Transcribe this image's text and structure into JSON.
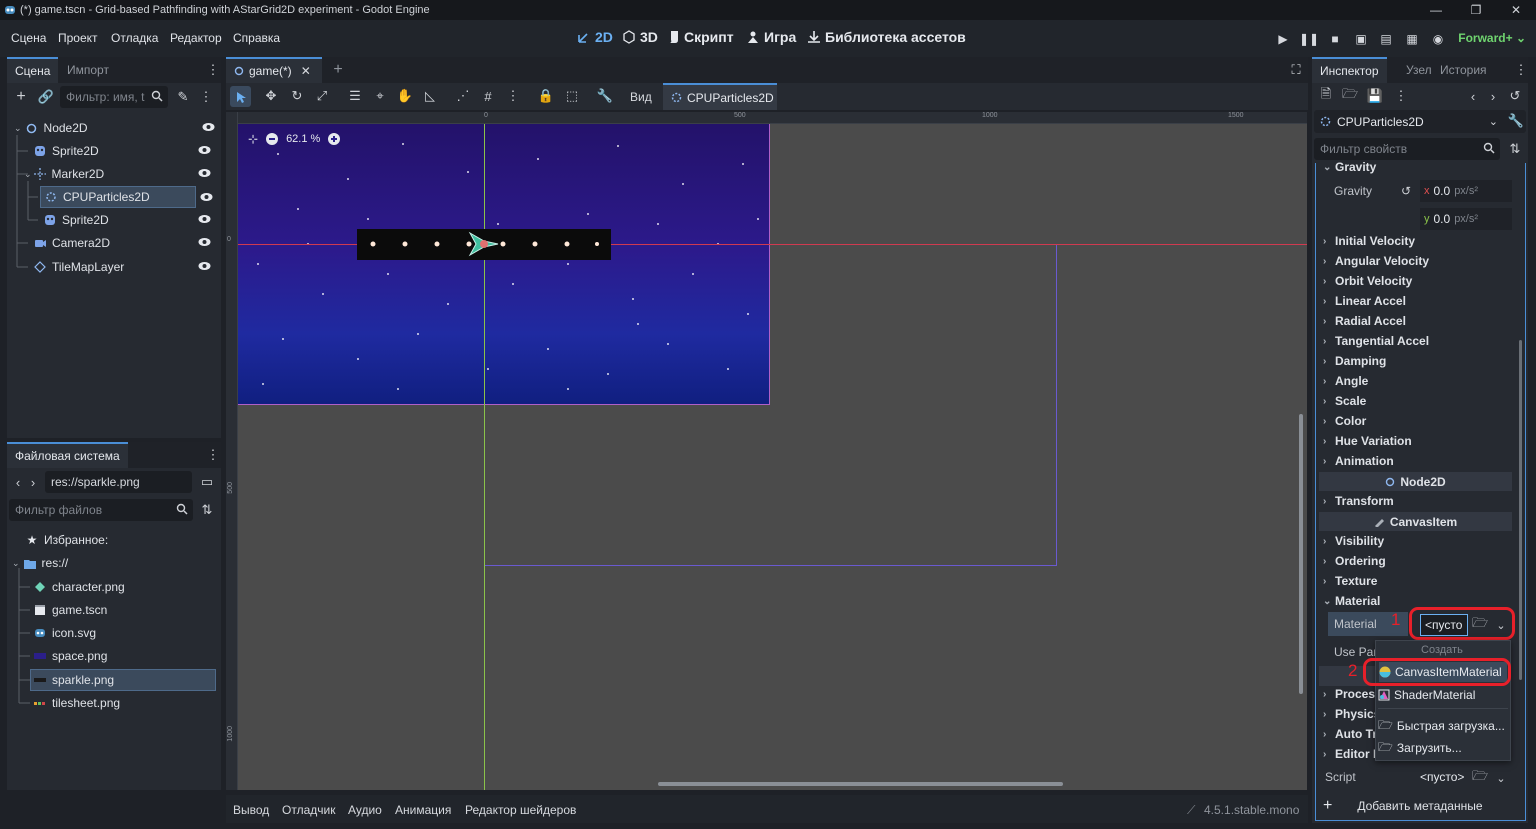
{
  "window": {
    "title": "(*) game.tscn - Grid-based Pathfinding with AStarGrid2D experiment - Godot Engine",
    "minimize": "—",
    "restore": "❐",
    "close": "✕"
  },
  "menu": [
    "Сцена",
    "Проект",
    "Отладка",
    "Редактор",
    "Справка"
  ],
  "workspaces": [
    "2D",
    "3D",
    "Скрипт",
    "Игра",
    "Библиотека ассетов"
  ],
  "renderer": "Forward+",
  "scene_dock": {
    "tabs": [
      "Сцена",
      "Импорт"
    ],
    "filter_placeholder": "Фильтр: имя, t",
    "nodes": [
      "Node2D",
      "Sprite2D",
      "Marker2D",
      "CPUParticles2D",
      "Sprite2D",
      "Camera2D",
      "TileMapLayer"
    ]
  },
  "filesystem_dock": {
    "tab": "Файловая система",
    "path": "res://sparkle.png",
    "filter_placeholder": "Фильтр файлов",
    "favorites": "Избранное:",
    "root": "res://",
    "files": [
      "character.png",
      "game.tscn",
      "icon.svg",
      "space.png",
      "sparkle.png",
      "tilesheet.png"
    ]
  },
  "editor": {
    "scene_tab": "game(*)",
    "view_label": "Вид",
    "selected_node": "CPUParticles2D",
    "zoom": "62.1 %",
    "ruler_labels": [
      "0",
      "500",
      "1000",
      "1500"
    ],
    "vruler_labels": [
      "0",
      "500",
      "1000"
    ]
  },
  "bottom_panel": {
    "tabs": [
      "Вывод",
      "Отладчик",
      "Аудио",
      "Анимация",
      "Редактор шейдеров"
    ],
    "version": "4.5.1.stable.mono"
  },
  "inspector": {
    "tabs": [
      "Инспектор",
      "Узел",
      "История"
    ],
    "node": "CPUParticles2D",
    "filter_placeholder": "Фильтр свойств",
    "gravity_group": "Gravity",
    "gravity_label": "Gravity",
    "gravity_x_axis": "x",
    "gravity_x": "0.0",
    "gravity_y_axis": "y",
    "gravity_y": "0.0",
    "gravity_unit": "px/s²",
    "sections": [
      "Initial Velocity",
      "Angular Velocity",
      "Orbit Velocity",
      "Linear Accel",
      "Radial Accel",
      "Tangential Accel",
      "Damping",
      "Angle",
      "Scale",
      "Color",
      "Hue Variation",
      "Animation"
    ],
    "node2d_header": "Node2D",
    "transform": "Transform",
    "canvasitem_header": "CanvasItem",
    "canvas_sections": [
      "Visibility",
      "Ordering",
      "Texture",
      "Material"
    ],
    "material_label": "Material",
    "material_value": "<пусто",
    "use_parent_label": "Use Par",
    "lower_sections": [
      "Process",
      "Physics",
      "Auto Tra",
      "Editor D"
    ],
    "script_label": "Script",
    "script_value": "<пусто>",
    "add_metadata": "Добавить метаданные"
  },
  "material_dropdown": {
    "create_label": "Создать",
    "items": [
      "CanvasItemMaterial",
      "ShaderMaterial",
      "Быстрая загрузка...",
      "Загрузить..."
    ]
  },
  "annotations": {
    "marker_1": "1",
    "marker_2": "2",
    "color": "#e8202a"
  },
  "colors": {
    "accent": "#4a8ed6",
    "renderer": "#6fd46f",
    "selection": "#3b4a5c"
  }
}
